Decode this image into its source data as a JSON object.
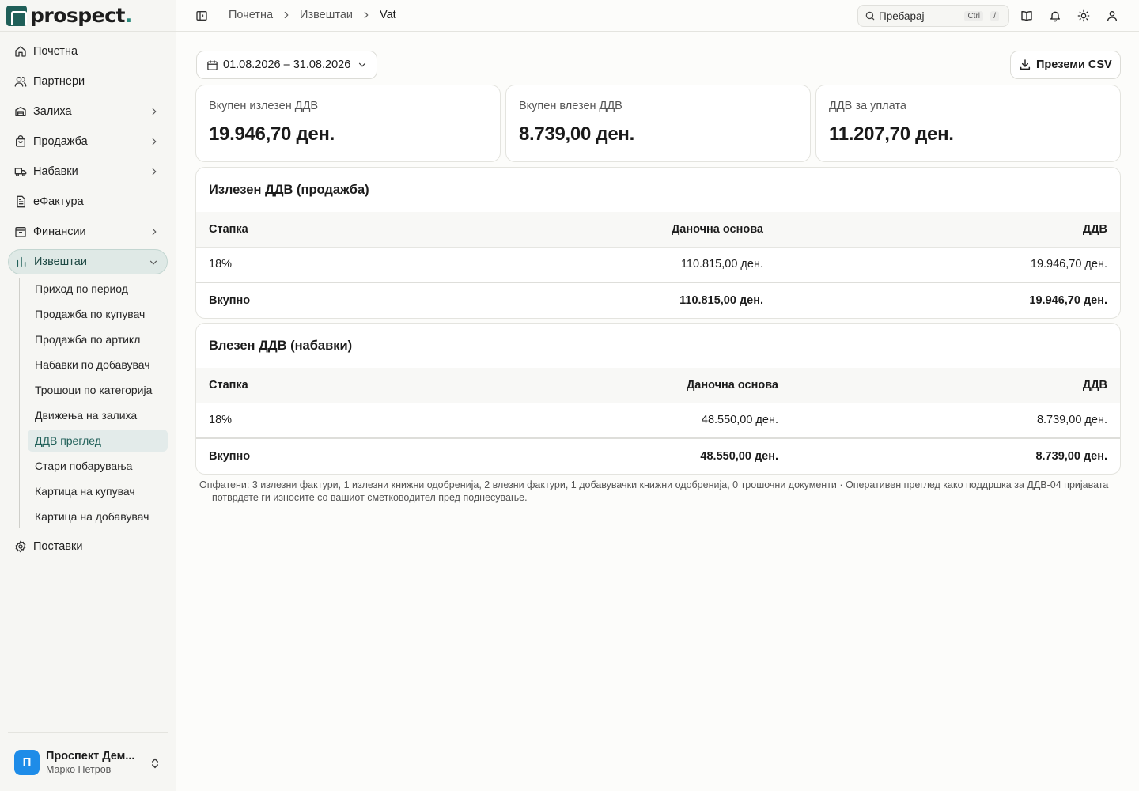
{
  "brand": {
    "name": "prospect",
    "dot": "."
  },
  "sidebar": {
    "items": [
      {
        "label": "Почетна",
        "icon": "home-icon"
      },
      {
        "label": "Партнери",
        "icon": "users-icon"
      },
      {
        "label": "Залиха",
        "icon": "warehouse-icon"
      },
      {
        "label": "Продажба",
        "icon": "shopping-bag-icon"
      },
      {
        "label": "Набавки",
        "icon": "truck-icon"
      },
      {
        "label": "еФактура",
        "icon": "document-icon"
      },
      {
        "label": "Финансии",
        "icon": "wallet-icon"
      },
      {
        "label": "Извештаи",
        "icon": "bar-chart-icon"
      }
    ],
    "reports_sub": [
      "Приход по период",
      "Продажба по купувач",
      "Продажба по артикл",
      "Набавки по добавувач",
      "Трошоци по категорија",
      "Движења на залиха",
      "ДДВ преглед",
      "Стари побарувања",
      "Картица на купувач",
      "Картица на добавувач"
    ],
    "settings_label": "Поставки",
    "account": {
      "initial": "П",
      "company": "Проспект Дем...",
      "user": "Марко Петров"
    }
  },
  "topbar": {
    "breadcrumbs": [
      "Почетна",
      "Извештаи",
      "Vat"
    ],
    "search_placeholder": "Пребарај",
    "shortcut_ctrl": "Ctrl",
    "shortcut_key": "/"
  },
  "toolbar": {
    "date_range": "01.08.2026 – 31.08.2026",
    "download_label": "Преземи CSV"
  },
  "kpis": [
    {
      "label": "Вкупен излезен ДДВ",
      "value": "19.946,70 ден."
    },
    {
      "label": "Вкупен влезен ДДВ",
      "value": "8.739,00 ден."
    },
    {
      "label": "ДДВ за уплата",
      "value": "11.207,70 ден."
    }
  ],
  "output_vat": {
    "title": "Излезен ДДВ (продажба)",
    "headers": {
      "rate": "Стапка",
      "base": "Даночна основа",
      "vat": "ДДВ"
    },
    "row": {
      "rate": "18%",
      "base": "110.815,00 ден.",
      "vat": "19.946,70 ден."
    },
    "total": {
      "label": "Вкупно",
      "base": "110.815,00 ден.",
      "vat": "19.946,70 ден."
    }
  },
  "input_vat": {
    "title": "Влезен ДДВ (набавки)",
    "headers": {
      "rate": "Стапка",
      "base": "Даночна основа",
      "vat": "ДДВ"
    },
    "row": {
      "rate": "18%",
      "base": "48.550,00 ден.",
      "vat": "8.739,00 ден."
    },
    "total": {
      "label": "Вкупно",
      "base": "48.550,00 ден.",
      "vat": "8.739,00 ден."
    }
  },
  "footnote": "Опфатени: 3 излезни фактури, 1 излезни книжни одобренија, 2 влезни фактури, 1 добавувачки книжни одобренија, 0 трошочни документи · Оперативен преглед како поддршка за ДДВ-04 пријавата — потврдете ги износите со вашиот сметководител пред поднесување.",
  "colors": {
    "accent": "#1f5f58",
    "avatar": "#1e8ce8",
    "active_bg": "#dfe9e6"
  }
}
